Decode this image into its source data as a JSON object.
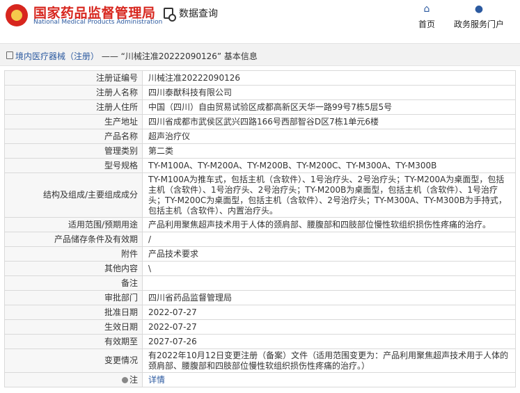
{
  "header": {
    "brand_cn": "国家药品监督管理局",
    "brand_en": "National Medical Products Administration",
    "query_label": "数据查询",
    "nav": [
      {
        "label": "首页",
        "icon": "home-icon"
      },
      {
        "label": "政务服务门户",
        "icon": "user-icon"
      }
    ]
  },
  "breadcrumb": {
    "category": "境内医疗器械（注册）",
    "separator": "——",
    "record": "“川械注准20222090126”",
    "suffix": "基本信息"
  },
  "rows": [
    {
      "key": "注册证编号",
      "value": "川械注准20222090126"
    },
    {
      "key": "注册人名称",
      "value": "四川泰猷科技有限公司"
    },
    {
      "key": "注册人住所",
      "value": "中国（四川）自由贸易试验区成都高新区天华一路99号7栋5层5号"
    },
    {
      "key": "生产地址",
      "value": "四川省成都市武侯区武兴四路166号西部智谷D区7栋1单元6楼"
    },
    {
      "key": "产品名称",
      "value": "超声治疗仪"
    },
    {
      "key": "管理类别",
      "value": "第二类"
    },
    {
      "key": "型号规格",
      "value": "TY-M100A、TY-M200A、TY-M200B、TY-M200C、TY-M300A、TY-M300B"
    },
    {
      "key": "结构及组成/主要组成成分",
      "value": "TY-M100A为推车式，包括主机（含软件）、1号治疗头、2号治疗头；TY-M200A为桌面型，包括主机（含软件）、1号治疗头、2号治疗头；TY-M200B为桌面型，包括主机（含软件）、1号治疗头；TY-M200C为桌面型，包括主机（含软件）、2号治疗头；TY-M300A、TY-M300B为手持式，包括主机（含软件）、内置治疗头。"
    },
    {
      "key": "适用范围/预期用途",
      "value": "产品利用聚焦超声技术用于人体的颈肩部、腰腹部和四肢部位慢性软组织损伤性疼痛的治疗。"
    },
    {
      "key": "产品储存条件及有效期",
      "value": "/"
    },
    {
      "key": "附件",
      "value": "产品技术要求"
    },
    {
      "key": "其他内容",
      "value": "\\"
    },
    {
      "key": "备注",
      "value": ""
    },
    {
      "key": "审批部门",
      "value": "四川省药品监督管理局"
    },
    {
      "key": "批准日期",
      "value": "2022-07-27"
    },
    {
      "key": "生效日期",
      "value": "2022-07-27"
    },
    {
      "key": "有效期至",
      "value": "2027-07-26"
    },
    {
      "key": "变更情况",
      "value": "有2022年10月12日变更注册（备案）文件（适用范围变更为：产品利用聚焦超声技术用于人体的颈肩部、腰腹部和四肢部位慢性软组织损伤性疼痛的治疗。）"
    }
  ],
  "note": {
    "key": "注",
    "link": "详情"
  }
}
